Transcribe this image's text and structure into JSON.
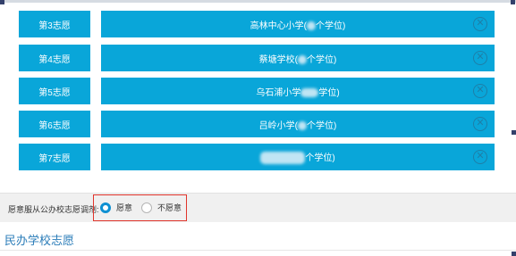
{
  "choices": [
    {
      "label": "第3志愿",
      "school_prefix": "高林中心小学(",
      "school_suffix": "个学位)",
      "remove_symbol": "✕"
    },
    {
      "label": "第4志愿",
      "school_prefix": "蔡塘学校(",
      "school_suffix": "个学位)",
      "remove_symbol": "✕"
    },
    {
      "label": "第5志愿",
      "school_prefix": "乌石浦小学",
      "school_suffix": "学位)",
      "remove_symbol": "✕"
    },
    {
      "label": "第6志愿",
      "school_prefix": "吕岭小学(",
      "school_suffix": "个学位)",
      "remove_symbol": "✕"
    },
    {
      "label": "第7志愿",
      "school_prefix": "",
      "school_suffix": "个学位)",
      "remove_symbol": "✕"
    }
  ],
  "public_adjustment": {
    "label": "愿意服从公办校志愿调剂:",
    "options": [
      {
        "label": "愿意",
        "selected": true
      },
      {
        "label": "不愿意",
        "selected": false
      }
    ]
  },
  "private_section": {
    "title": "民办学校志愿"
  },
  "colors": {
    "button_blue": "#09a6d9",
    "remove_icon": "#1d7fa8",
    "radio_selected": "#0e90d2",
    "highlight_border": "#e0342b",
    "section_title": "#2a7cb8"
  }
}
